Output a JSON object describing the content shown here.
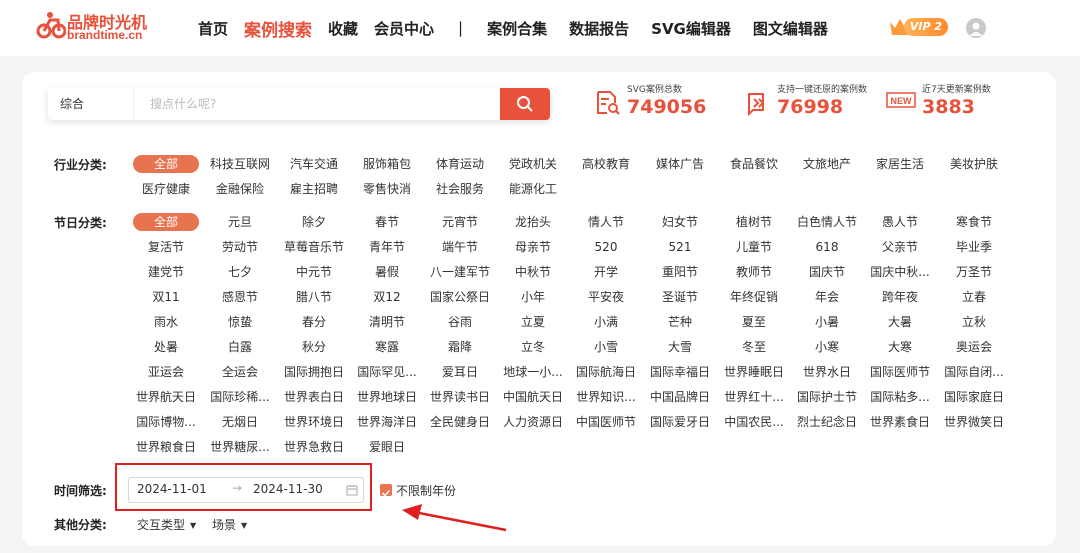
{
  "brand": {
    "name_cn": "品牌时光机",
    "name_en": "brandtime.cn"
  },
  "nav": {
    "items": [
      "首页",
      "案例搜索",
      "收藏",
      "会员中心"
    ],
    "separator": "|",
    "items2": [
      "案例合集",
      "数据报告",
      "SVG编辑器",
      "图文编辑器"
    ],
    "active": "案例搜索"
  },
  "vip": {
    "label": "VIP 2"
  },
  "search": {
    "type": "综合",
    "placeholder": "搜点什么呢?"
  },
  "stats": [
    {
      "label": "SVG案例总数",
      "value": "749056",
      "icon": "document-search-icon"
    },
    {
      "label": "支持一键还原的案例数",
      "value": "76998",
      "icon": "restore-icon"
    },
    {
      "label": "近7天更新案例数",
      "value": "3883",
      "icon": "new-badge-icon"
    }
  ],
  "filters": {
    "industry_label": "行业分类:",
    "industry": [
      "全部",
      "科技互联网",
      "汽车交通",
      "服饰箱包",
      "体育运动",
      "党政机关",
      "高校教育",
      "媒体广告",
      "食品餐饮",
      "文旅地产",
      "家居生活",
      "美妆护肤",
      "医疗健康",
      "金融保险",
      "雇主招聘",
      "零售快消",
      "社会服务",
      "能源化工"
    ],
    "festival_label": "节日分类:",
    "festival": [
      "全部",
      "元旦",
      "除夕",
      "春节",
      "元宵节",
      "龙抬头",
      "情人节",
      "妇女节",
      "植树节",
      "白色情人节",
      "愚人节",
      "寒食节",
      "复活节",
      "劳动节",
      "草莓音乐节",
      "青年节",
      "端午节",
      "母亲节",
      "520",
      "521",
      "儿童节",
      "618",
      "父亲节",
      "毕业季",
      "建党节",
      "七夕",
      "中元节",
      "暑假",
      "八一建军节",
      "中秋节",
      "开学",
      "重阳节",
      "教师节",
      "国庆节",
      "国庆中秋...",
      "万圣节",
      "双11",
      "感恩节",
      "腊八节",
      "双12",
      "国家公祭日",
      "小年",
      "平安夜",
      "圣诞节",
      "年终促销",
      "年会",
      "跨年夜",
      "立春",
      "雨水",
      "惊蛰",
      "春分",
      "清明节",
      "谷雨",
      "立夏",
      "小满",
      "芒种",
      "夏至",
      "小暑",
      "大暑",
      "立秋",
      "处暑",
      "白露",
      "秋分",
      "寒露",
      "霜降",
      "立冬",
      "小雪",
      "大雪",
      "冬至",
      "小寒",
      "大寒",
      "奥运会",
      "亚运会",
      "全运会",
      "国际拥抱日",
      "国际罕见...",
      "爱耳日",
      "地球一小...",
      "国际航海日",
      "国际幸福日",
      "世界睡眠日",
      "世界水日",
      "国际医师节",
      "国际自闭...",
      "世界航天日",
      "国际珍稀...",
      "世界表白日",
      "世界地球日",
      "世界读书日",
      "中国航天日",
      "世界知识...",
      "中国品牌日",
      "世界红十...",
      "国际护士节",
      "国际粘多...",
      "国际家庭日",
      "国际博物...",
      "无烟日",
      "世界环境日",
      "世界海洋日",
      "全民健身日",
      "人力资源日",
      "中国医师节",
      "国际爱牙日",
      "中国农民...",
      "烈士纪念日",
      "世界素食日",
      "世界微笑日",
      "世界粮食日",
      "世界糖尿...",
      "世界急救日",
      "爱眼日"
    ],
    "time_label": "时间筛选:",
    "date_start": "2024-11-01",
    "date_arrow": "→",
    "date_end": "2024-11-30",
    "unlimited_year": "不限制年份",
    "other_label": "其他分类:",
    "dropdowns": [
      "交互类型",
      "场景"
    ]
  },
  "colors": {
    "accent": "#e8513a",
    "tag_active": "#e8734f",
    "highlight": "#e02020"
  }
}
